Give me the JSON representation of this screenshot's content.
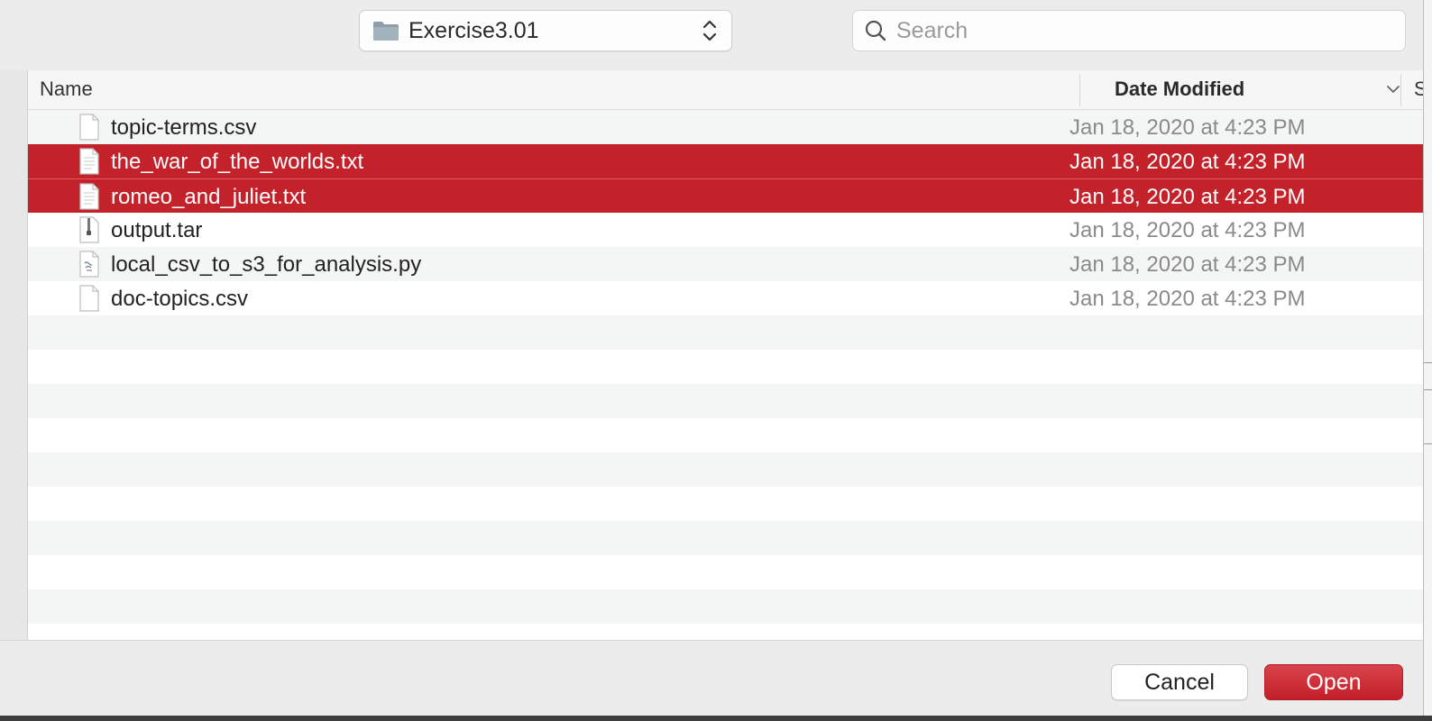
{
  "toolbar": {
    "location": "Exercise3.01",
    "search_placeholder": "Search"
  },
  "columns": {
    "name": "Name",
    "date_modified": "Date Modified",
    "size_partial": "S"
  },
  "files": [
    {
      "name": "topic-terms.csv",
      "date": "Jan 18, 2020 at 4:23 PM",
      "icon": "blank-document-icon",
      "selected": false
    },
    {
      "name": "the_war_of_the_worlds.txt",
      "date": "Jan 18, 2020 at 4:23 PM",
      "icon": "text-document-icon",
      "selected": true
    },
    {
      "name": "romeo_and_juliet.txt",
      "date": "Jan 18, 2020 at 4:23 PM",
      "icon": "text-document-icon",
      "selected": true
    },
    {
      "name": "output.tar",
      "date": "Jan 18, 2020 at 4:23 PM",
      "icon": "archive-icon",
      "selected": false
    },
    {
      "name": "local_csv_to_s3_for_analysis.py",
      "date": "Jan 18, 2020 at 4:23 PM",
      "icon": "script-document-icon",
      "selected": false
    },
    {
      "name": "doc-topics.csv",
      "date": "Jan 18, 2020 at 4:23 PM",
      "icon": "blank-document-icon",
      "selected": false
    }
  ],
  "buttons": {
    "cancel": "Cancel",
    "open": "Open"
  },
  "colors": {
    "selection": "#c4222b",
    "accent_button": "#c82a32"
  }
}
